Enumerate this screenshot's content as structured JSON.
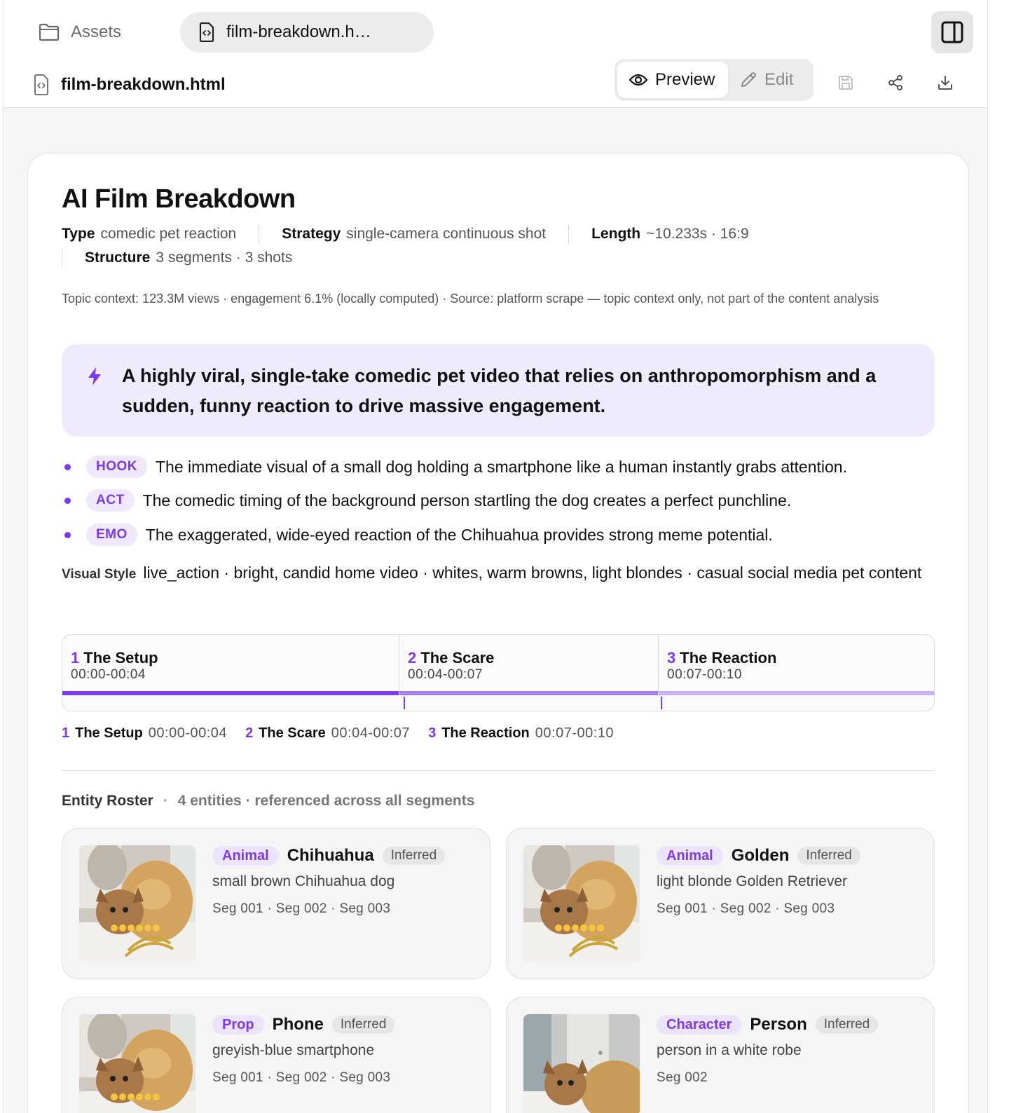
{
  "tabs": {
    "assets_label": "Assets",
    "file_label": "film-breakdown.h…"
  },
  "docbar": {
    "filename": "film-breakdown.html",
    "preview_label": "Preview",
    "edit_label": "Edit"
  },
  "report": {
    "title": "AI Film Breakdown",
    "meta": {
      "type_label": "Type",
      "type_value": "comedic pet reaction",
      "strategy_label": "Strategy",
      "strategy_value": "single-camera continuous shot",
      "length_label": "Length",
      "length_value": "~10.233s · 16:9",
      "structure_label": "Structure",
      "structure_value": "3 segments · 3 shots"
    },
    "topic_context": "Topic context: 123.3M views · engagement 6.1% (locally computed) · Source: platform scrape — topic context only, not part of the content analysis",
    "callout": "A highly viral, single-take comedic pet video that relies on anthropomorphism and a sudden, funny reaction to drive massive engagement.",
    "bullets": [
      {
        "tag": "HOOK",
        "text": "The immediate visual of a small dog holding a smartphone like a human instantly grabs attention."
      },
      {
        "tag": "ACT",
        "text": "The comedic timing of the background person startling the dog creates a perfect punchline."
      },
      {
        "tag": "EMO",
        "text": "The exaggerated, wide-eyed reaction of the Chihuahua provides strong meme potential."
      }
    ],
    "visual_style_label": "Visual Style",
    "visual_style_value": "live_action · bright, candid home video · whites, warm browns, light blondes · casual social media pet content",
    "segments": [
      {
        "num": "1",
        "name": "The Setup",
        "time": "00:00-00:04"
      },
      {
        "num": "2",
        "name": "The Scare",
        "time": "00:04-00:07"
      },
      {
        "num": "3",
        "name": "The Reaction",
        "time": "00:07-00:10"
      }
    ],
    "roster": {
      "title": "Entity Roster",
      "summary": "4 entities · referenced across all segments",
      "entities": [
        {
          "type": "Animal",
          "name": "Chihuahua",
          "status": "Inferred",
          "desc": "small brown Chihuahua dog",
          "segs": "Seg 001 · Seg 002 · Seg 003"
        },
        {
          "type": "Animal",
          "name": "Golden",
          "status": "Inferred",
          "desc": "light blonde Golden Retriever",
          "segs": "Seg 001 · Seg 002 · Seg 003"
        },
        {
          "type": "Prop",
          "name": "Phone",
          "status": "Inferred",
          "desc": "greyish-blue smartphone",
          "segs": "Seg 001 · Seg 002 · Seg 003"
        },
        {
          "type": "Character",
          "name": "Person",
          "status": "Inferred",
          "desc": "person in a white robe",
          "segs": "Seg 002"
        }
      ]
    }
  },
  "colors": {
    "accent": "#7c3aed",
    "accent_light": "#efe9fb",
    "callout_bg": "#f0ebfc"
  },
  "icons": [
    "folder-icon",
    "code-file-icon",
    "panel-toggle-icon",
    "eye-icon",
    "pencil-icon",
    "save-icon",
    "share-icon",
    "download-icon",
    "bolt-icon"
  ]
}
